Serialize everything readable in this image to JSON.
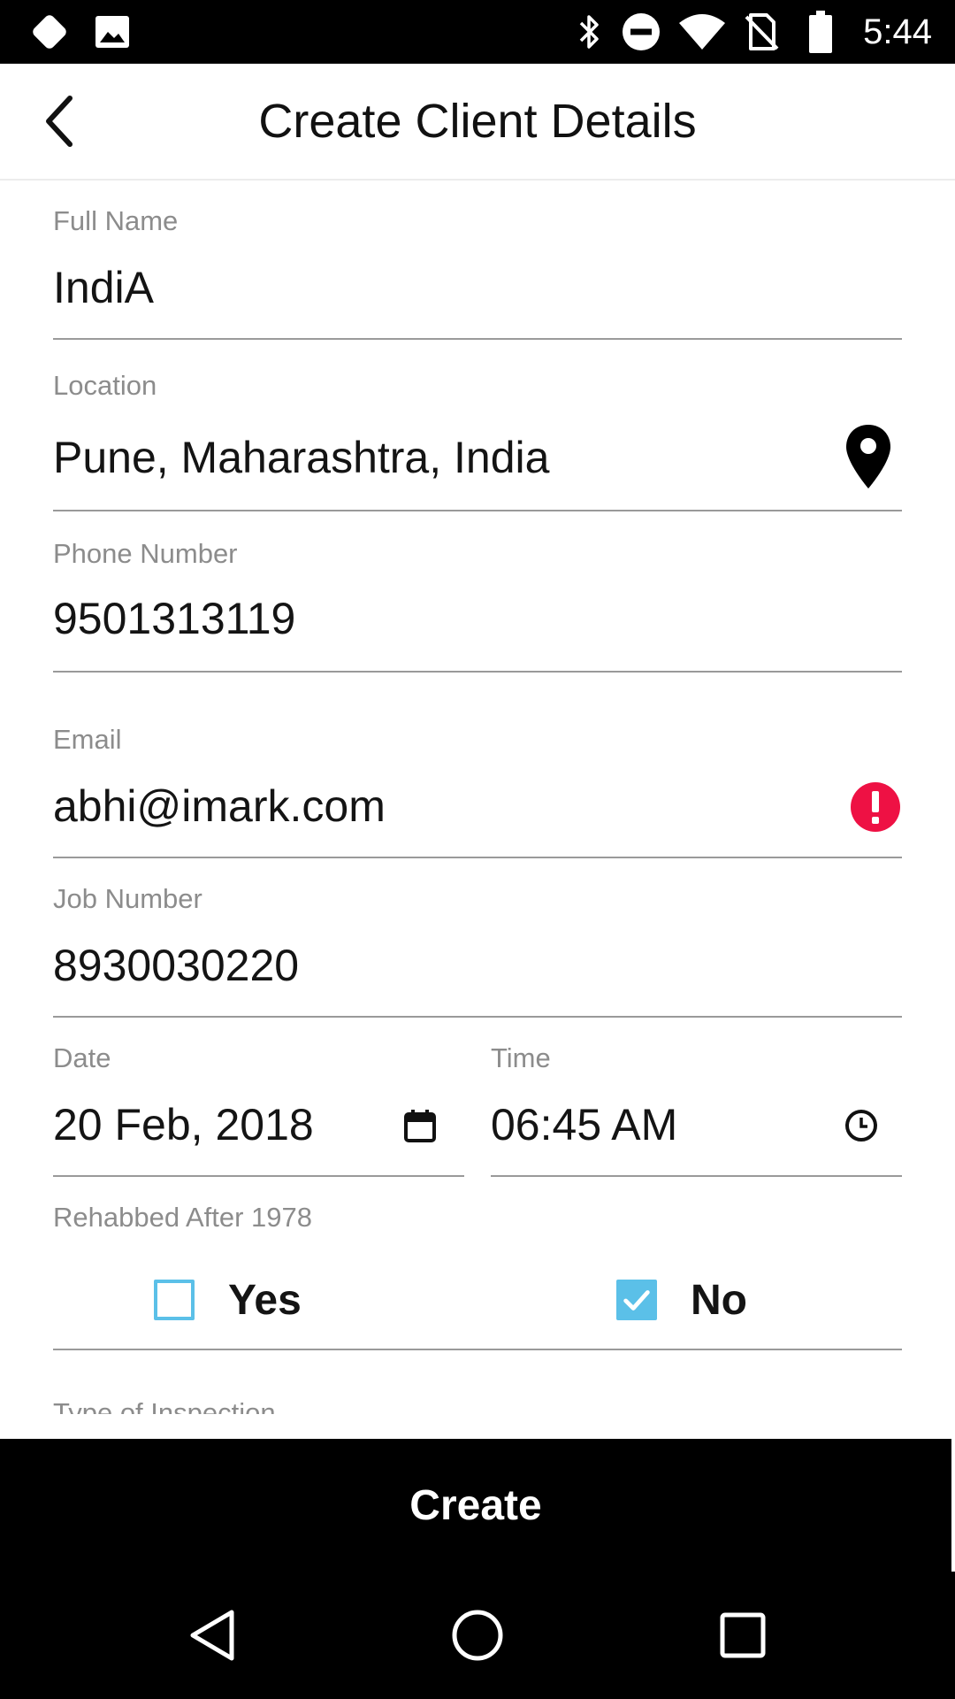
{
  "status_bar": {
    "time": "5:44",
    "icons": [
      "app-notification-icon",
      "image-notification-icon",
      "bluetooth-icon",
      "do-not-disturb-icon",
      "wifi-icon",
      "no-sim-icon",
      "battery-icon"
    ]
  },
  "header": {
    "title": "Create Client Details",
    "back_icon": "chevron-left-icon"
  },
  "form": {
    "full_name": {
      "label": "Full Name",
      "value": "IndiA"
    },
    "location": {
      "label": "Location",
      "value": "Pune, Maharashtra, India",
      "icon": "location-pin-icon"
    },
    "phone": {
      "label": "Phone Number",
      "value": "9501313119"
    },
    "email": {
      "label": "Email",
      "value": "abhi@imark.com",
      "icon": "error-icon",
      "icon_color": "#ee1144"
    },
    "job_number": {
      "label": "Job Number",
      "value": "8930030220"
    },
    "date": {
      "label": "Date",
      "value": "20 Feb, 2018",
      "icon": "calendar-icon"
    },
    "time": {
      "label": "Time",
      "value": "06:45 AM",
      "icon": "clock-icon"
    },
    "rehabbed": {
      "label": "Rehabbed After 1978",
      "options": [
        {
          "label": "Yes",
          "checked": false
        },
        {
          "label": "No",
          "checked": true
        }
      ],
      "check_color": "#5bc0e8"
    },
    "inspection_type": {
      "label": "Type of Inspection"
    }
  },
  "actions": {
    "create_label": "Create"
  },
  "nav_bar": {
    "icons": [
      "back-triangle-icon",
      "home-circle-icon",
      "recents-square-icon"
    ]
  }
}
